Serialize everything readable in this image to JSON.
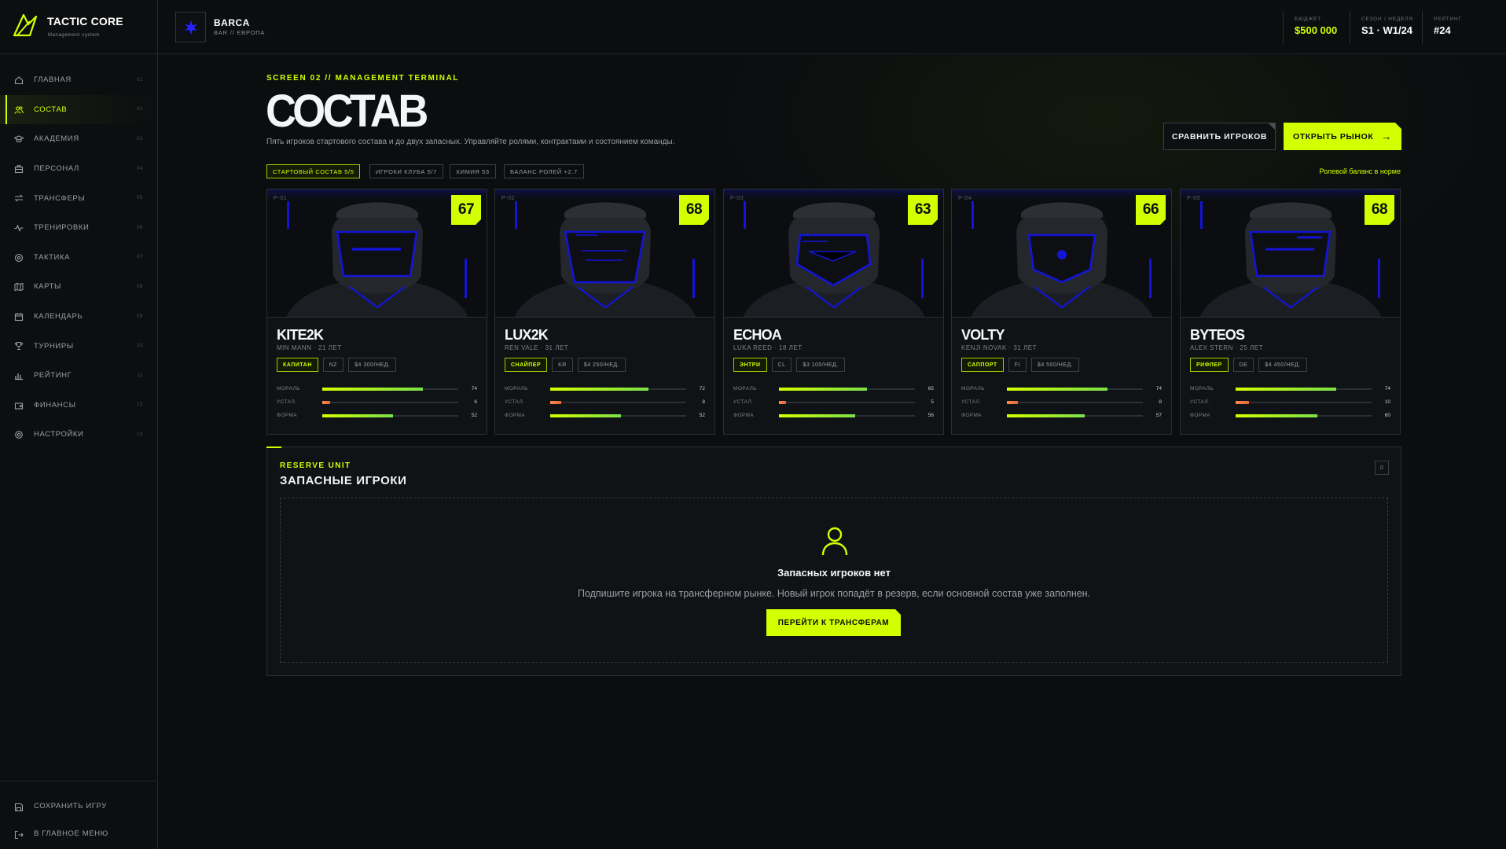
{
  "brand": {
    "name": "TACTIC CORE",
    "subtitle": "Management system"
  },
  "sidebar": {
    "items": [
      {
        "label": "Главная",
        "num": "01",
        "icon": "home-icon"
      },
      {
        "label": "Состав",
        "num": "02",
        "icon": "users-icon",
        "active": true
      },
      {
        "label": "Академия",
        "num": "03",
        "icon": "graduation-cap-icon"
      },
      {
        "label": "Персонал",
        "num": "04",
        "icon": "briefcase-icon"
      },
      {
        "label": "Трансферы",
        "num": "05",
        "icon": "transfer-arrows-icon"
      },
      {
        "label": "Тренировки",
        "num": "06",
        "icon": "activity-icon"
      },
      {
        "label": "Тактика",
        "num": "07",
        "icon": "target-icon"
      },
      {
        "label": "Карты",
        "num": "08",
        "icon": "map-icon"
      },
      {
        "label": "Календарь",
        "num": "09",
        "icon": "calendar-icon"
      },
      {
        "label": "Турниры",
        "num": "10",
        "icon": "trophy-icon"
      },
      {
        "label": "Рейтинг",
        "num": "11",
        "icon": "bar-chart-icon"
      },
      {
        "label": "Финансы",
        "num": "12",
        "icon": "wallet-icon"
      },
      {
        "label": "Настройки",
        "num": "13",
        "icon": "gear-icon"
      }
    ],
    "bottom": [
      {
        "label": "Сохранить игру",
        "icon": "save-icon"
      },
      {
        "label": "В главное меню",
        "icon": "logout-icon"
      }
    ]
  },
  "team": {
    "name": "BARCA",
    "region": "BAR // ЕВРОПА"
  },
  "stats": {
    "budget": {
      "label": "Бюджет",
      "value": "$500 000"
    },
    "season": {
      "label": "Сезон / неделя",
      "value": "S1 · W1/24"
    },
    "rank": {
      "label": "Рейтинг",
      "value": "#24"
    }
  },
  "page": {
    "kicker": "SCREEN 02 // MANAGEMENT TERMINAL",
    "title": "СОСТАВ",
    "description": "Пять игроков стартового состава и до двух запасных. Управляйте ролями, контрактами и состоянием команды.",
    "compare_button": "СРАВНИТЬ ИГРОКОВ",
    "market_button": "ОТКРЫТЬ РЫНОК",
    "chips": [
      "Стартовый состав 5/5",
      "Игроки клуба 5/7",
      "Химия 53",
      "Баланс ролей +2.7"
    ],
    "balance_note": "Ролевой баланс в норме"
  },
  "stat_labels": {
    "morale": "Мораль",
    "fatigue": "Устал.",
    "form": "Форма"
  },
  "colors": {
    "accent": "#d4ff00",
    "background": "#0b0d0f",
    "player_visor": "#1414d6"
  },
  "players": [
    {
      "id": "P-01",
      "ovr": "67",
      "nick": "KITE2K",
      "real": "MIN MANN · 21 ЛЕТ",
      "role": "Капитан",
      "country": "NZ",
      "salary": "$4 300/НЕД.",
      "morale": 74,
      "fatigue": 6,
      "form": 52
    },
    {
      "id": "P-02",
      "ovr": "68",
      "nick": "LUX2K",
      "real": "REN VALE · 31 ЛЕТ",
      "role": "Снайпер",
      "country": "KR",
      "salary": "$4 250/НЕД.",
      "morale": 72,
      "fatigue": 8,
      "form": 52
    },
    {
      "id": "P-03",
      "ovr": "63",
      "nick": "ECHOA",
      "real": "LUKA REED · 18 ЛЕТ",
      "role": "Энтри",
      "country": "CL",
      "salary": "$3 100/НЕД.",
      "morale": 65,
      "fatigue": 5,
      "form": 56
    },
    {
      "id": "P-04",
      "ovr": "66",
      "nick": "VOLTY",
      "real": "KENJI NOVAK · 31 ЛЕТ",
      "role": "Саппорт",
      "country": "FI",
      "salary": "$4 500/НЕД.",
      "morale": 74,
      "fatigue": 8,
      "form": 57
    },
    {
      "id": "P-05",
      "ovr": "68",
      "nick": "BYTEOS",
      "real": "ALEX STERN · 25 ЛЕТ",
      "role": "Рифлер",
      "country": "DE",
      "salary": "$4 450/НЕД.",
      "morale": 74,
      "fatigue": 10,
      "form": 60
    }
  ],
  "reserve": {
    "kicker": "RESERVE UNIT",
    "title": "ЗАПАСНЫЕ ИГРОКИ",
    "count": "0",
    "empty_title": "Запасных игроков нет",
    "empty_desc": "Подпишите игрока на трансферном рынке. Новый игрок попадёт в резерв, если основной состав уже заполнен.",
    "empty_button": "ПЕРЕЙТИ К ТРАНСФЕРАМ"
  }
}
